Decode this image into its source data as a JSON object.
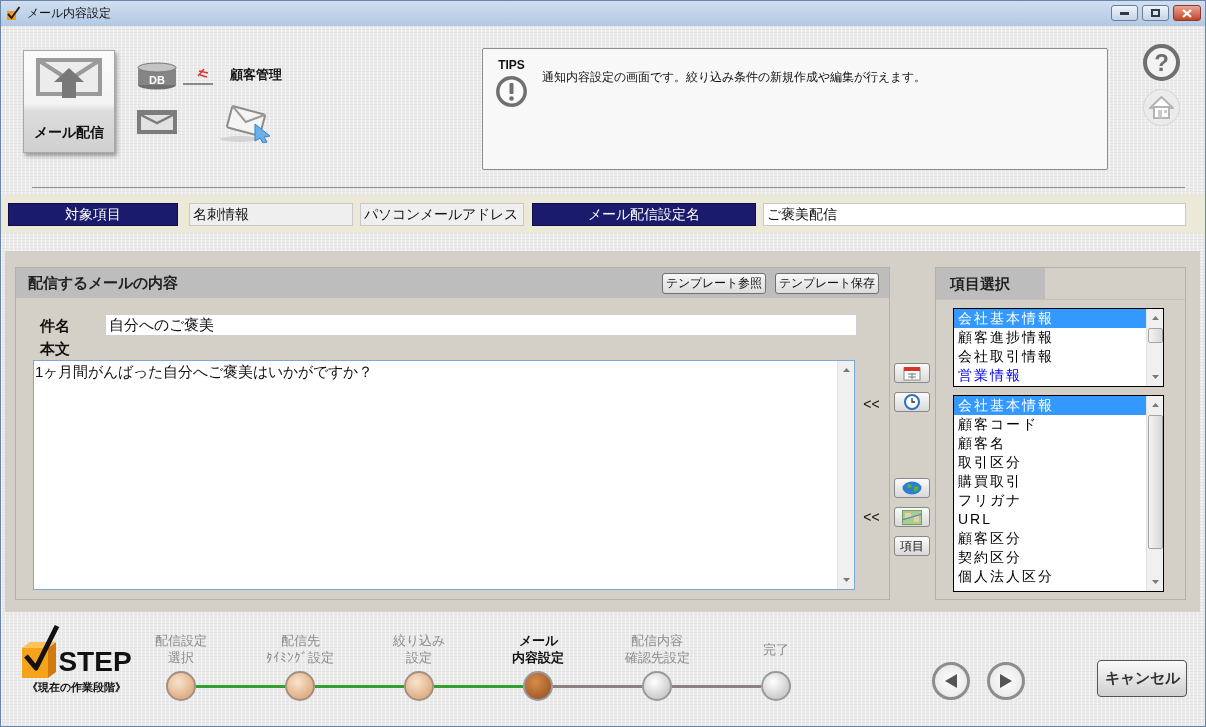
{
  "window": {
    "title": "メール内容設定"
  },
  "header": {
    "main_button": "メール配信",
    "db_label": "DB",
    "app_name": "顧客管理",
    "tips": {
      "heading": "TIPS",
      "message": "通知内容設定の画面です。絞り込み条件の新規作成や編集が行えます。"
    },
    "help_symbol": "?"
  },
  "info_bar": [
    {
      "kind": "label",
      "text": "対象項目"
    },
    {
      "kind": "readonly",
      "text": "名刺情報"
    },
    {
      "kind": "readonly",
      "text": "パソコンメールアドレス"
    },
    {
      "kind": "label",
      "text": "メール配信設定名"
    },
    {
      "kind": "input",
      "text": "ご褒美配信"
    }
  ],
  "mail_content": {
    "title": "配信するメールの内容",
    "buttons": [
      "テンプレート参照",
      "テンプレート保存"
    ],
    "subject_label": "件名",
    "subject": "自分へのご褒美",
    "body_label": "本文",
    "body": "1ヶ月間がんばった自分へご褒美はいかがですか？"
  },
  "insert_tools": [
    {
      "arrow": "<<",
      "buttons": [
        {
          "kind": "calendar"
        },
        {
          "kind": "clock"
        }
      ]
    },
    {
      "arrow": "<<",
      "buttons": [
        {
          "kind": "globe"
        },
        {
          "kind": "map"
        },
        {
          "kind": "text",
          "label": "項目"
        }
      ]
    }
  ],
  "item_selection": {
    "title": "項目選択",
    "categories": [
      {
        "label": "会社基本情報",
        "selected": true,
        "emphasized": false
      },
      {
        "label": "顧客進捗情報",
        "selected": false,
        "emphasized": false
      },
      {
        "label": "会社取引情報",
        "selected": false,
        "emphasized": false
      },
      {
        "label": "営業情報",
        "selected": false,
        "emphasized": true
      }
    ],
    "fields": [
      {
        "label": "会社基本情報",
        "selected": true
      },
      {
        "label": "顧客コード",
        "selected": false
      },
      {
        "label": "顧客名",
        "selected": false
      },
      {
        "label": "取引区分",
        "selected": false
      },
      {
        "label": "購買取引",
        "selected": false
      },
      {
        "label": "フリガナ",
        "selected": false
      },
      {
        "label": "URL",
        "selected": false
      },
      {
        "label": "顧客区分",
        "selected": false
      },
      {
        "label": "契約区分",
        "selected": false
      },
      {
        "label": "個人法人区分",
        "selected": false
      }
    ]
  },
  "steps": {
    "logo": "STEP",
    "caption": "《現在の作業段階》",
    "items": [
      {
        "lines": [
          "配信設定",
          "選択"
        ],
        "completed": true,
        "current": false
      },
      {
        "lines": [
          "配信先",
          "ﾀｲﾐﾝｸﾞ設定"
        ],
        "completed": true,
        "current": false
      },
      {
        "lines": [
          "絞り込み",
          "設定"
        ],
        "completed": true,
        "current": false
      },
      {
        "lines": [
          "メール",
          "内容設定"
        ],
        "completed": false,
        "current": true
      },
      {
        "lines": [
          "配信内容",
          "確認先設定"
        ],
        "completed": false,
        "current": false
      },
      {
        "lines": [
          "完了"
        ],
        "completed": false,
        "current": false
      }
    ]
  },
  "navigation": [
    {
      "kind": "back"
    },
    {
      "kind": "forward"
    }
  ],
  "cancel_button": "キャンセル"
}
